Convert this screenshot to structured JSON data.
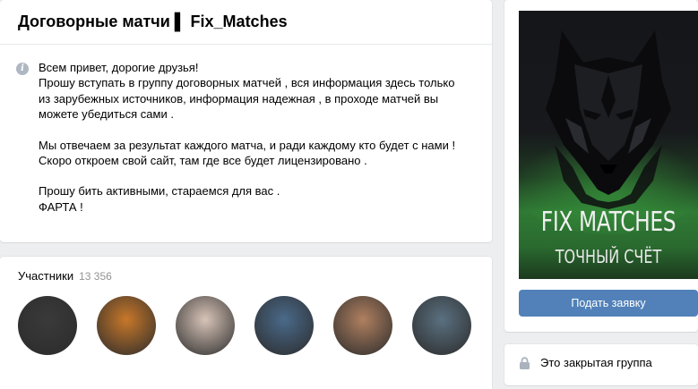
{
  "group": {
    "title": "Договорные матчи ▌ Fix_Matches"
  },
  "description": {
    "lines_1": [
      "Всем привет, дорогие друзья!",
      "Прошу вступать в группу договорных матчей , вся информация здесь только",
      "из зарубежных источников, информация надежная , в проходе матчей вы",
      "можете убедиться сами ."
    ],
    "lines_2": [
      "Мы отвечаем за результат каждого матча, и ради каждому кто будет с нами !",
      "Скоро откроем свой сайт, там где все будет лицензировано ."
    ],
    "lines_3": [
      "Прошу бить активными, стараемся для вас .",
      "ФАРТА !"
    ]
  },
  "members": {
    "title": "Участники",
    "count": "13 356",
    "avatar_colors": [
      "#3a3a3a",
      "#c8782a",
      "#d8c4b8",
      "#4a6a8a",
      "#b08060",
      "#5a7080"
    ]
  },
  "sidebar": {
    "cover_title": "FIX MATCHES",
    "cover_subtitle": "ТОЧНЫЙ СЧЁТ",
    "join_label": "Подать заявку",
    "closed_label": "Это закрытая группа"
  },
  "colors": {
    "accent": "#5181b8",
    "background": "#edeef0"
  },
  "icons": [
    "info-icon",
    "lock-icon",
    "wolf-logo"
  ]
}
